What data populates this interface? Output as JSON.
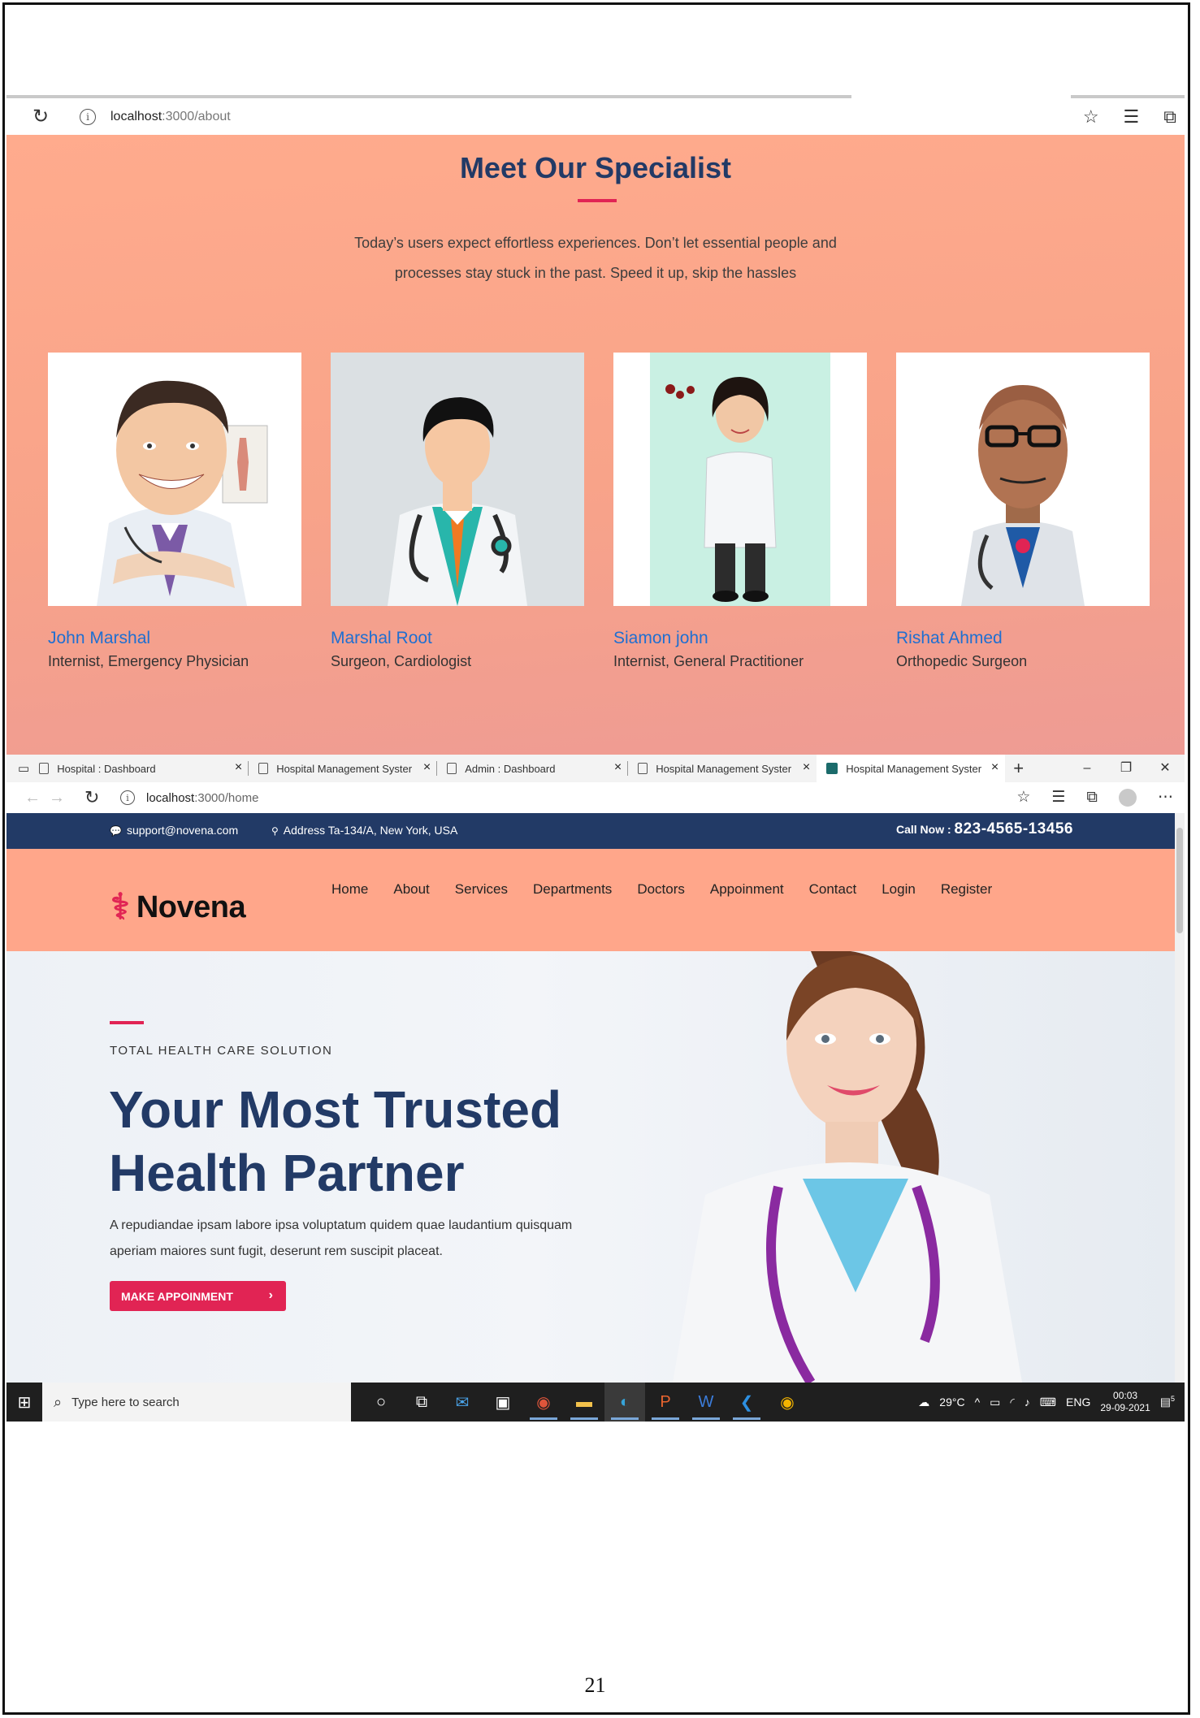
{
  "about_window": {
    "url_host": "localhost",
    "url_path": ":3000/about",
    "title": "Meet Our Specialist",
    "description": "Today’s users expect effortless experiences. Don’t let essential people and processes stay stuck in the past. Speed it up, skip the hassles",
    "doctors": [
      {
        "name": "John Marshal",
        "specialty": "Internist, Emergency Physician"
      },
      {
        "name": "Marshal Root",
        "specialty": "Surgeon, Cardiologist"
      },
      {
        "name": "Siamon john",
        "specialty": "Internist, General Practitioner"
      },
      {
        "name": "Rishat Ahmed",
        "specialty": "Orthopedic Surgeon"
      }
    ]
  },
  "home_window": {
    "tabs": [
      {
        "title": "Hospital : Dashboard"
      },
      {
        "title": "Hospital Management Syster"
      },
      {
        "title": "Admin : Dashboard"
      },
      {
        "title": "Hospital Management Syster"
      },
      {
        "title": "Hospital Management Syster"
      }
    ],
    "url_host": "localhost",
    "url_path": ":3000/home",
    "topbar": {
      "email": "support@novena.com",
      "address": "Address Ta-134/A, New York, USA",
      "call_label": "Call Now : ",
      "phone": "823-4565-13456"
    },
    "brand": "Novena",
    "menu": [
      "Home",
      "About",
      "Services",
      "Departments",
      "Doctors",
      "Appoinment",
      "Contact",
      "Login",
      "Register"
    ],
    "hero": {
      "kicker": "TOTAL HEALTH CARE SOLUTION",
      "heading_line1": "Your Most Trusted",
      "heading_line2": "Health Partner",
      "lead": "A repudiandae ipsam labore ipsa voluptatum quidem quae laudantium quisquam aperiam maiores sunt fugit, deserunt rem suscipit placeat.",
      "button": "MAKE APPOINMENT",
      "button_chevron": "›"
    }
  },
  "taskbar": {
    "search_placeholder": "Type here to search",
    "weather": "29°C",
    "lang": "ENG",
    "time": "00:03",
    "date": "29-09-2021",
    "notif_count": "5"
  },
  "page_number": "21",
  "colors": {
    "accent": "#e12454",
    "navy": "#223a66",
    "peach": "#ffa68a",
    "link_blue": "#1f6fd1"
  }
}
